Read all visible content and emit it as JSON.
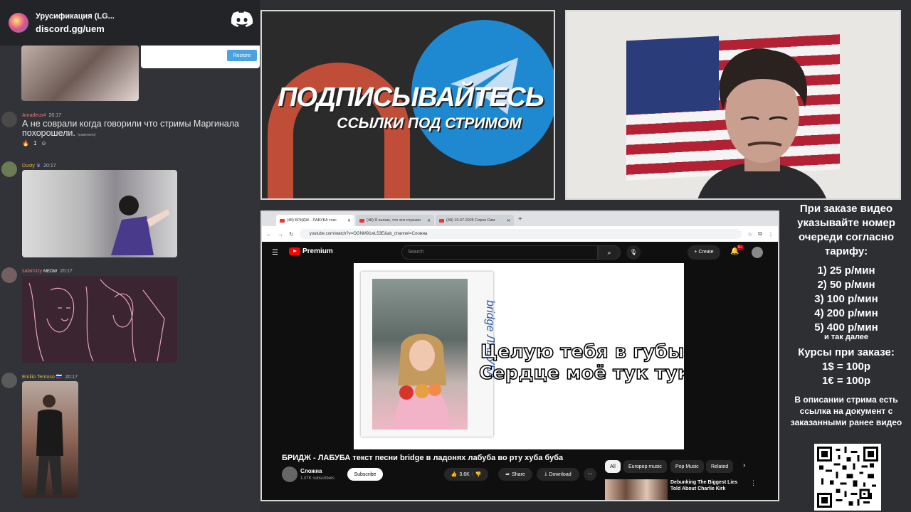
{
  "discord": {
    "server_name": "Урусификация (LG...",
    "invite": "discord.gg/uem",
    "restore_label": "Restore",
    "messages": [
      {
        "author": "Amadeus4",
        "time": "20:17",
        "text": "А не соврали когда говорили что стримы Маргинала похорошели.",
        "edited": "(изменено)",
        "reaction_count": "1",
        "author_color": "#e5787c"
      },
      {
        "author": "Dusty",
        "time": "20:17",
        "author_color": "#f0b232"
      },
      {
        "author": "salam1ty",
        "badge": "MEOW",
        "time": "20:17",
        "author_color": "#e5787c"
      },
      {
        "author": "Emilio Terrioso",
        "time": "20:17",
        "author_color": "#e5b84c"
      }
    ]
  },
  "promo": {
    "title": "ПОДПИСЫВАЙТЕСЬ",
    "subtitle": "ССЫЛКИ ПОД СТРИМОМ",
    "red_color": "#d9533a",
    "blue_color": "#1e88d0"
  },
  "browser": {
    "tabs": [
      {
        "label": "(48) БРИДЖ - ЛАБУБА текс"
      },
      {
        "label": "(48) Я калаю, что эти слушаю"
      },
      {
        "label": "(48) 10.07.2025 Сорок Сим"
      }
    ],
    "url": "youtube.com/watch?v=OGNM91wL53E&ab_channel=Сложна",
    "youtube": {
      "logo_text": "Premium",
      "search_placeholder": "Search",
      "create_label": "Create",
      "notif_badge": "9+",
      "lyric_line1": "Целую тебя в губы",
      "lyric_line2": "Сердце моё тук тук",
      "video_side_text": "bridge ЛАБУБА",
      "video_title": "БРИДЖ - ЛАБУБА текст песни bridge в ладонях лабуба во рту хуба буба",
      "channel_name": "Сложна",
      "channel_subs": "1.07K subscribers",
      "subscribe_label": "Subscribe",
      "like_count": "3.6K",
      "share_label": "Share",
      "download_label": "Download",
      "chips": [
        "All",
        "Europop music",
        "Pop Music",
        "Related"
      ],
      "rec_title": "Debunking The Biggest Lies Told About Charlie Kirk"
    }
  },
  "info": {
    "order_text": "При заказе видео указывайте номер очереди согласно тарифу:",
    "tariffs": [
      "1) 25 р/мин",
      "2) 50 р/мин",
      "3) 100 р/мин",
      "4) 200 р/мин",
      "5) 400 р/мин"
    ],
    "etc": "и так далее",
    "rates_title": "Курсы при заказе:",
    "rates": [
      "1$ = 100р",
      "1€ = 100р"
    ],
    "description": "В описании стрима есть ссылка на документ с заказанными ранее видео"
  }
}
